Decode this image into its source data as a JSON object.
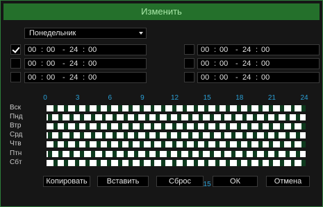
{
  "dialog": {
    "title": "Изменить"
  },
  "day_select": {
    "value": "Понедельник"
  },
  "periods": [
    {
      "enabled": true,
      "start_h": "00",
      "start_m": "00",
      "end_h": "24",
      "end_m": "00"
    },
    {
      "enabled": false,
      "start_h": "00",
      "start_m": "00",
      "end_h": "24",
      "end_m": "00"
    },
    {
      "enabled": false,
      "start_h": "00",
      "start_m": "00",
      "end_h": "24",
      "end_m": "00"
    },
    {
      "enabled": false,
      "start_h": "00",
      "start_m": "00",
      "end_h": "24",
      "end_m": "00"
    },
    {
      "enabled": false,
      "start_h": "00",
      "start_m": "00",
      "end_h": "24",
      "end_m": "00"
    },
    {
      "enabled": false,
      "start_h": "00",
      "start_m": "00",
      "end_h": "24",
      "end_m": "00"
    }
  ],
  "time_sep": ":",
  "range_sep": "-",
  "schedule": {
    "hours": [
      "0",
      "3",
      "6",
      "9",
      "12",
      "15",
      "18",
      "21",
      "24"
    ],
    "days": [
      "Вск",
      "Пнд",
      "Втр",
      "Срд",
      "Чтв",
      "Птн",
      "Сбт"
    ],
    "colors": {
      "recorded": "#ffffff",
      "background": "#0e3a1e",
      "hours": "#2a9fd6"
    }
  },
  "buttons": {
    "copy": "Копировать",
    "paste": "Вставить",
    "reset": "Сброс",
    "ok": "ОК",
    "cancel": "Отмена"
  }
}
